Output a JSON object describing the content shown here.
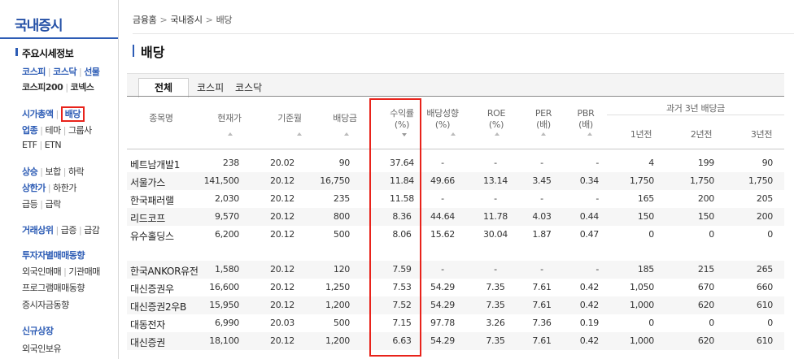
{
  "lnb": {
    "title": "국내증시",
    "section_head": "주요시세정보",
    "rows": [
      [
        {
          "t": "코스피",
          "s": "blue"
        },
        {
          "t": "코스닥",
          "s": "blue"
        },
        {
          "t": "선물",
          "s": "blue"
        }
      ],
      [
        {
          "t": "코스피200",
          "s": "dark"
        },
        {
          "t": "코넥스",
          "s": "dark"
        }
      ],
      [
        {
          "t": "시가총액",
          "s": "blue"
        },
        {
          "t": "배당",
          "s": "boxed"
        }
      ],
      [
        {
          "t": "업종",
          "s": "blue"
        },
        {
          "t": "테마",
          "s": "plain"
        },
        {
          "t": "그룹사",
          "s": "plain"
        }
      ],
      [
        {
          "t": "ETF",
          "s": "plain"
        },
        {
          "t": "ETN",
          "s": "plain"
        }
      ],
      [
        {
          "t": "상승",
          "s": "blue"
        },
        {
          "t": "보합",
          "s": "plain"
        },
        {
          "t": "하락",
          "s": "plain"
        }
      ],
      [
        {
          "t": "상한가",
          "s": "blue"
        },
        {
          "t": "하한가",
          "s": "plain"
        }
      ],
      [
        {
          "t": "급등",
          "s": "plain"
        },
        {
          "t": "급락",
          "s": "plain"
        }
      ],
      [
        {
          "t": "거래상위",
          "s": "blue"
        },
        {
          "t": "급증",
          "s": "plain"
        },
        {
          "t": "급감",
          "s": "plain"
        }
      ],
      [
        {
          "t": "투자자별매매동향",
          "s": "blue"
        }
      ],
      [
        {
          "t": "외국인매매",
          "s": "plain"
        },
        {
          "t": "기관매매",
          "s": "plain"
        }
      ],
      [
        {
          "t": "프로그램매매동향",
          "s": "plain"
        }
      ],
      [
        {
          "t": "증시자금동향",
          "s": "plain"
        }
      ],
      [
        {
          "t": "신규상장",
          "s": "blue"
        }
      ],
      [
        {
          "t": "외국인보유",
          "s": "plain"
        }
      ]
    ]
  },
  "breadcrumb": [
    "금융홈",
    "국내증시",
    "배당"
  ],
  "page_title": "배당",
  "tabs": [
    "전체",
    "코스피",
    "코스닥"
  ],
  "table": {
    "headers": {
      "name": "종목명",
      "price": "현재가",
      "base_month": "기준월",
      "dividend": "배당금",
      "yield_l1": "수익률",
      "yield_l2": "(%)",
      "payout_l1": "배당성향",
      "payout_l2": "(%)",
      "roe_l1": "ROE",
      "roe_l2": "(%)",
      "per_l1": "PER",
      "per_l2": "(배)",
      "pbr_l1": "PBR",
      "pbr_l2": "(배)",
      "past3": "과거 3년 배당금",
      "y1": "1년전",
      "y2": "2년전",
      "y3": "3년전"
    },
    "rows": [
      [
        "베트남개발1",
        "238",
        "20.02",
        "90",
        "37.64",
        "-",
        "-",
        "-",
        "-",
        "4",
        "199",
        "90"
      ],
      [
        "서울가스",
        "141,500",
        "20.12",
        "16,750",
        "11.84",
        "49.66",
        "13.14",
        "3.45",
        "0.34",
        "1,750",
        "1,750",
        "1,750"
      ],
      [
        "한국패러랠",
        "2,030",
        "20.12",
        "235",
        "11.58",
        "-",
        "-",
        "-",
        "-",
        "165",
        "200",
        "205"
      ],
      [
        "리드코프",
        "9,570",
        "20.12",
        "800",
        "8.36",
        "44.64",
        "11.78",
        "4.03",
        "0.44",
        "150",
        "150",
        "200"
      ],
      [
        "유수홀딩스",
        "6,200",
        "20.12",
        "500",
        "8.06",
        "15.62",
        "30.04",
        "1.87",
        "0.47",
        "0",
        "0",
        "0"
      ],
      [
        "한국ANKOR유전",
        "1,580",
        "20.12",
        "120",
        "7.59",
        "-",
        "-",
        "-",
        "-",
        "185",
        "215",
        "265"
      ],
      [
        "대신증권우",
        "16,600",
        "20.12",
        "1,250",
        "7.53",
        "54.29",
        "7.35",
        "7.61",
        "0.42",
        "1,050",
        "670",
        "660"
      ],
      [
        "대신증권2우B",
        "15,950",
        "20.12",
        "1,200",
        "7.52",
        "54.29",
        "7.35",
        "7.61",
        "0.42",
        "1,000",
        "620",
        "610"
      ],
      [
        "대동전자",
        "6,990",
        "20.03",
        "500",
        "7.15",
        "97.78",
        "3.26",
        "7.36",
        "0.19",
        "0",
        "0",
        "0"
      ],
      [
        "대신증권",
        "18,100",
        "20.12",
        "1,200",
        "6.63",
        "54.29",
        "7.35",
        "7.61",
        "0.42",
        "1,000",
        "620",
        "610"
      ]
    ]
  },
  "colors": {
    "accent": "#2d5cb5",
    "highlight": "#e8231b"
  }
}
